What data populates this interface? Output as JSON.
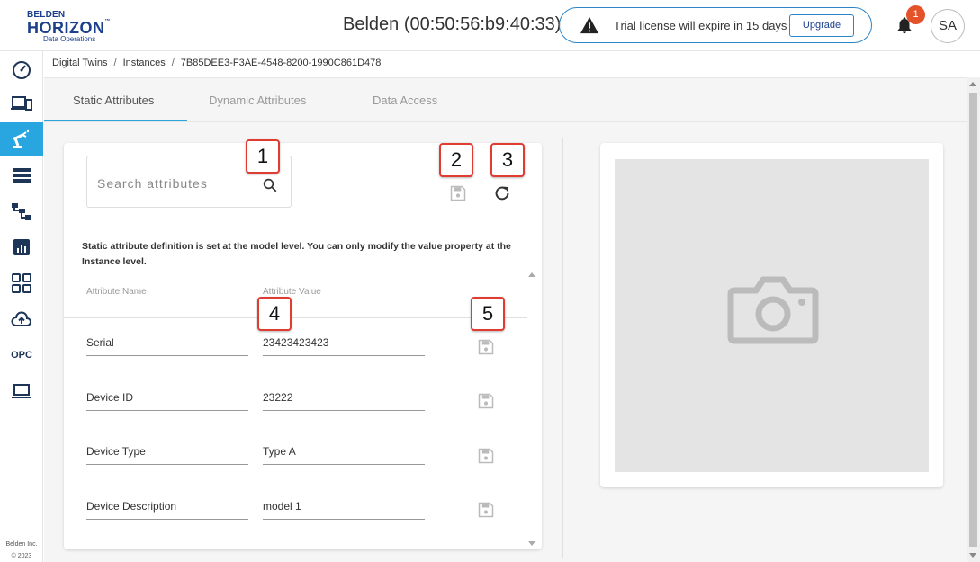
{
  "brand": {
    "line1": "BELDEN",
    "line2": "HORIZON",
    "trademark": "™",
    "line3": "Data Operations"
  },
  "header": {
    "device_title": "Belden (00:50:56:b9:40:33)",
    "trial_message": "Trial license will expire in 15 days",
    "upgrade_label": "Upgrade",
    "notification_count": "1",
    "avatar_initials": "SA"
  },
  "sidebar": {
    "items": [
      {
        "icon": "dashboard-icon"
      },
      {
        "icon": "devices-icon"
      },
      {
        "icon": "robot-arm-icon",
        "active": true
      },
      {
        "icon": "list-icon"
      },
      {
        "icon": "hierarchy-icon"
      },
      {
        "icon": "report-icon"
      },
      {
        "icon": "grid-icon"
      },
      {
        "icon": "cloud-upload-icon"
      },
      {
        "label": "OPC"
      },
      {
        "icon": "laptop-icon"
      }
    ],
    "footer_line1": "Belden Inc.",
    "footer_line2": "© 2023",
    "active_color": "#29a6df"
  },
  "breadcrumb": {
    "items": [
      "Digital Twins",
      "Instances"
    ],
    "separator": "/",
    "current": "7B85DEE3-F3AE-4548-8200-1990C861D478"
  },
  "tabs": [
    "Static Attributes",
    "Dynamic Attributes",
    "Data Access"
  ],
  "attributes": {
    "search_placeholder": "Search attributes",
    "note": "Static attribute definition is set at the model level. You can only modify the value property at the Instance level.",
    "col_name": "Attribute Name",
    "col_value": "Attribute Value",
    "rows": [
      {
        "name": "Serial",
        "value": "23423423423"
      },
      {
        "name": "Device ID",
        "value": "23222"
      },
      {
        "name": "Device Type",
        "value": "Type A"
      },
      {
        "name": "Device Description",
        "value": "model 1"
      }
    ]
  },
  "callouts": [
    "1",
    "2",
    "3",
    "4",
    "5"
  ],
  "colors": {
    "accent": "#29a6df",
    "brand_blue": "#1b3f8b",
    "notification": "#e4522a",
    "callout_border": "#e03c31"
  }
}
